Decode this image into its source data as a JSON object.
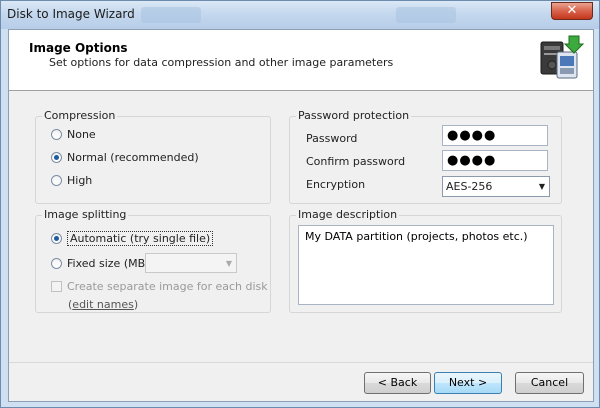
{
  "window": {
    "title": "Disk to Image Wizard"
  },
  "header": {
    "title": "Image Options",
    "subtitle": "Set options for data compression and other image parameters"
  },
  "compression": {
    "label": "Compression",
    "options": [
      "None",
      "Normal (recommended)",
      "High"
    ],
    "selected": "Normal (recommended)"
  },
  "password": {
    "label": "Password protection",
    "password_label": "Password",
    "password_value": "●●●●",
    "confirm_label": "Confirm password",
    "confirm_value": "●●●●",
    "encryption_label": "Encryption",
    "encryption_value": "AES-256"
  },
  "splitting": {
    "label": "Image splitting",
    "automatic": "Automatic (try single file)",
    "fixed": "Fixed size (MB)",
    "fixed_value": "",
    "selected": "automatic",
    "separate_label": "Create separate image for each disk",
    "separate_checked": false,
    "edit_names_prefix": "(",
    "edit_names_link": "edit names",
    "edit_names_suffix": ")"
  },
  "description": {
    "label": "Image description",
    "value": "My DATA partition (projects, photos etc.)"
  },
  "buttons": {
    "back": "< Back",
    "next": "Next >",
    "cancel": "Cancel"
  },
  "icons": {
    "close": "close-icon",
    "wizard": "disk-to-image-icon",
    "dropdown": "chevron-down-icon"
  }
}
